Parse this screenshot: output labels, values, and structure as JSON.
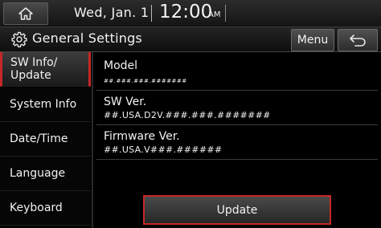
{
  "status_bar": {
    "date": "Wed, Jan. 1",
    "time": "12:00",
    "ampm": "AM"
  },
  "header": {
    "title": "General Settings",
    "menu_label": "Menu"
  },
  "sidebar": {
    "items": [
      {
        "label": "SW Info/\nUpdate",
        "active": true
      },
      {
        "label": "System Info",
        "active": false
      },
      {
        "label": "Date/Time",
        "active": false
      },
      {
        "label": "Language",
        "active": false
      },
      {
        "label": "Keyboard",
        "active": false
      }
    ]
  },
  "info": {
    "model_label": "Model",
    "model_value": "##.###.###.#######",
    "sw_label": "SW Ver.",
    "sw_value": "##.USA.D2V.###.###.#######",
    "fw_label": "Firmware Ver.",
    "fw_value": "##.USA.V###.######"
  },
  "actions": {
    "update_label": "Update"
  },
  "colors": {
    "accent": "#c62828",
    "background": "#000000",
    "text": "#f2f2f2"
  },
  "icons": {
    "home": "home-icon",
    "settings": "gear-icon",
    "back": "back-arrow-icon"
  }
}
